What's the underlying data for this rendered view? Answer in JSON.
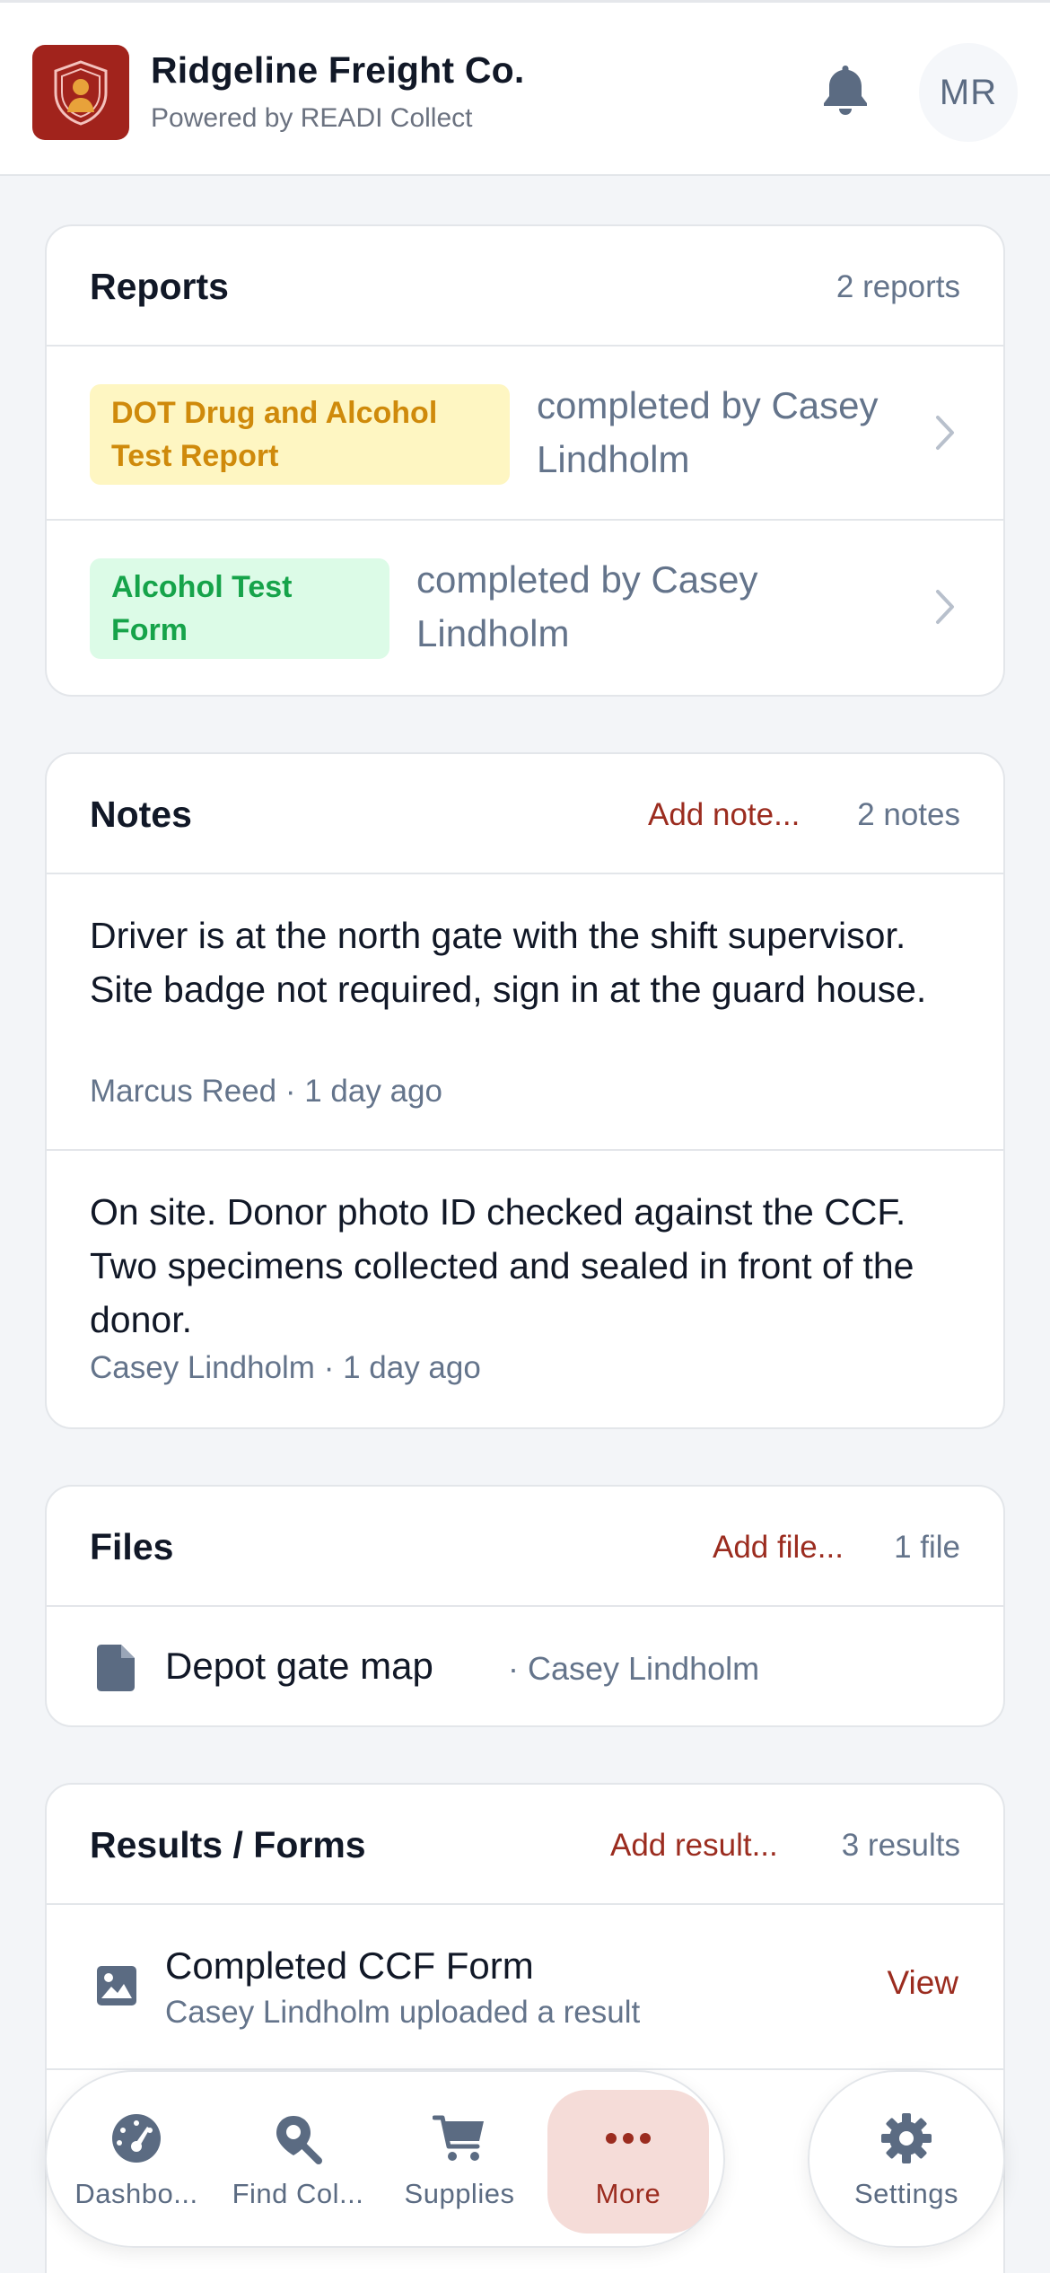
{
  "header": {
    "title": "Ridgeline Freight Co.",
    "subtitle": "Powered by READI Collect",
    "avatar_initials": "MR",
    "brand_color": "#a1231c"
  },
  "reports": {
    "title": "Reports",
    "count": "2 reports",
    "items": [
      {
        "badge": "DOT Drug and Alcohol Test Report",
        "badge_color": "yellow",
        "desc": "completed by Casey Lindholm"
      },
      {
        "badge": "Alcohol Test Form",
        "badge_color": "green",
        "desc": "completed by Casey Lindholm"
      }
    ]
  },
  "notes": {
    "title": "Notes",
    "add_label": "Add note...",
    "count": "2 notes",
    "items": [
      {
        "text": "Driver is at the north gate with the shift supervisor. Site badge not required, sign in at the guard house.",
        "meta": "Marcus Reed · 1 day ago"
      },
      {
        "text": "On site. Donor photo ID checked against the CCF. Two specimens collected and sealed in front of the donor.",
        "meta": "Casey Lindholm · 1 day ago"
      }
    ]
  },
  "files": {
    "title": "Files",
    "add_label": "Add file...",
    "count": "1 file",
    "items": [
      {
        "icon": "document-icon",
        "name": "Depot gate map",
        "author": "· Casey Lindholm"
      }
    ]
  },
  "results": {
    "title": "Results / Forms",
    "add_label": "Add result...",
    "count": "3 results",
    "items": [
      {
        "icon": "image-icon",
        "title": "Completed CCF Form",
        "subtitle": "Casey Lindholm uploaded a result",
        "action": "View"
      }
    ]
  },
  "nav": {
    "items": [
      {
        "label": "Dashbo...",
        "icon": "speedometer-icon"
      },
      {
        "label": "Find Col...",
        "icon": "map-search-icon"
      },
      {
        "label": "Supplies",
        "icon": "cart-icon"
      },
      {
        "label": "More",
        "icon": "more-dots-icon",
        "active": true
      }
    ],
    "settings_label": "Settings"
  }
}
